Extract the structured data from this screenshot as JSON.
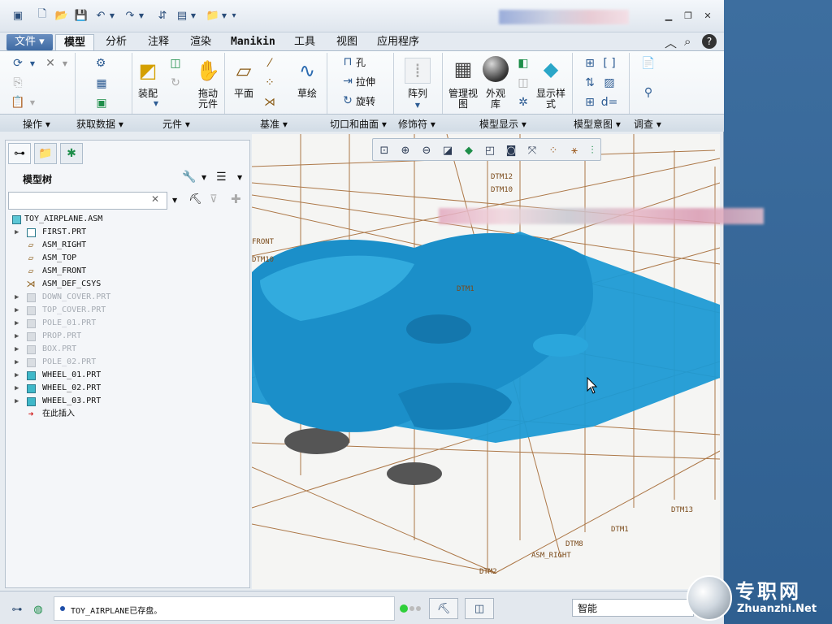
{
  "quick_access": [
    "window-icon",
    "new-icon",
    "open-icon",
    "save-icon",
    "undo-icon",
    "redo-icon",
    "regenerate-icon",
    "windows-icon",
    "folder-icon",
    "more-icon"
  ],
  "tabs": [
    {
      "label": "文件",
      "kind": "file"
    },
    {
      "label": "模型",
      "kind": "active"
    },
    {
      "label": "分析"
    },
    {
      "label": "注释"
    },
    {
      "label": "渲染"
    },
    {
      "label": "Manikin"
    },
    {
      "label": "工具"
    },
    {
      "label": "视图"
    },
    {
      "label": "应用程序"
    }
  ],
  "ribbon": {
    "assemble_label": "装配",
    "drag_label": "拖动\n元件",
    "plane_label": "平面",
    "sketch_label": "草绘",
    "hole_label": "孔",
    "extrude_label": "拉伸",
    "revolve_label": "旋转",
    "pattern_label": "阵列",
    "manage_view_label": "管理视\n图",
    "appearance_label": "外观\n库",
    "display_style_label": "显示样\n式",
    "groups": [
      "操作",
      "获取数据",
      "元件",
      "基准",
      "切口和曲面",
      "修饰符",
      "模型显示",
      "模型意图",
      "调查"
    ]
  },
  "model_tree": {
    "title": "模型树",
    "search_placeholder": "",
    "root": "TOY_AIRPLANE.ASM",
    "items": [
      {
        "label": "FIRST.PRT",
        "type": "part-first",
        "expand": true,
        "dim": false
      },
      {
        "label": "ASM_RIGHT",
        "type": "plane",
        "expand": false,
        "dim": false
      },
      {
        "label": "ASM_TOP",
        "type": "plane",
        "expand": false,
        "dim": false
      },
      {
        "label": "ASM_FRONT",
        "type": "plane",
        "expand": false,
        "dim": false
      },
      {
        "label": "ASM_DEF_CSYS",
        "type": "csys",
        "expand": false,
        "dim": false
      },
      {
        "label": "DOWN_COVER.PRT",
        "type": "part",
        "expand": true,
        "dim": true
      },
      {
        "label": "TOP_COVER.PRT",
        "type": "part",
        "expand": true,
        "dim": true
      },
      {
        "label": "POLE_01.PRT",
        "type": "part",
        "expand": true,
        "dim": true
      },
      {
        "label": "PROP.PRT",
        "type": "part",
        "expand": true,
        "dim": true
      },
      {
        "label": "BOX.PRT",
        "type": "part",
        "expand": true,
        "dim": true
      },
      {
        "label": "POLE_02.PRT",
        "type": "part",
        "expand": true,
        "dim": true
      },
      {
        "label": "WHEEL_01.PRT",
        "type": "part",
        "expand": true,
        "dim": false
      },
      {
        "label": "WHEEL_02.PRT",
        "type": "part",
        "expand": true,
        "dim": false
      },
      {
        "label": "WHEEL_03.PRT",
        "type": "part",
        "expand": true,
        "dim": false
      },
      {
        "label": "在此插入",
        "type": "insert",
        "expand": false,
        "dim": false
      }
    ]
  },
  "datum_labels": [
    "DTM12",
    "DTM10",
    "FRONT",
    "DTM10",
    "DTM1",
    "DTM13",
    "DTM1",
    "DTM8",
    "ASM_RIGHT",
    "DTM2"
  ],
  "status": {
    "message": "TOY_AIRPLANE已存盘。",
    "filter": "智能"
  },
  "watermark": {
    "text": "专职网",
    "url": "Zhuanzhi.Net"
  },
  "colors": {
    "model_blue": "#1e9ad4",
    "datum": "#a0622a"
  }
}
